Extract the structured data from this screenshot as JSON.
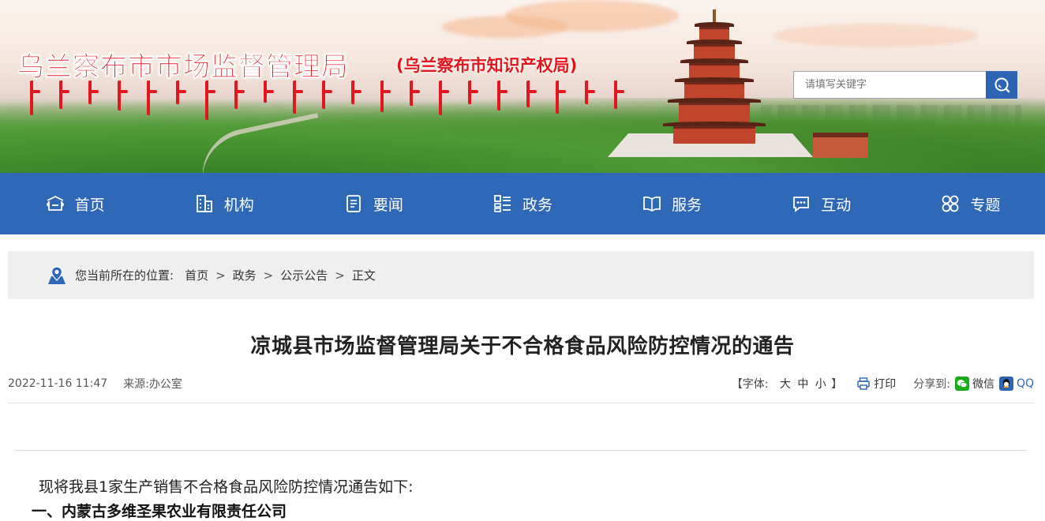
{
  "header": {
    "title": "乌兰察布市市场监督管理局",
    "subtitle": "(乌兰察布市知识产权局)",
    "search": {
      "placeholder": "请填写关键字"
    }
  },
  "nav": {
    "items": [
      {
        "label": "首页",
        "icon": "home-icon"
      },
      {
        "label": "机构",
        "icon": "building-icon"
      },
      {
        "label": "要闻",
        "icon": "news-icon"
      },
      {
        "label": "政务",
        "icon": "grid-list-icon"
      },
      {
        "label": "服务",
        "icon": "book-icon"
      },
      {
        "label": "互动",
        "icon": "chat-icon"
      },
      {
        "label": "专题",
        "icon": "clover-icon"
      }
    ]
  },
  "breadcrumb": {
    "prefix": "您当前所在的位置:",
    "items": [
      "首页",
      "政务",
      "公示公告",
      "正文"
    ],
    "separator": ">"
  },
  "article": {
    "title": "凉城县市场监督管理局关于不合格食品风险防控情况的通告",
    "date": "2022-11-16 11:47",
    "source": "来源:办公室",
    "font_label_open": "【字体:",
    "font_sizes": [
      "大",
      "中",
      "小"
    ],
    "font_label_close": "】",
    "print_label": "打印",
    "share_label": "分享到:",
    "share_wechat": "微信",
    "share_qq": "QQ",
    "paragraph1": "现将我县1家生产销售不合格食品风险防控情况通告如下:",
    "paragraph2": "一、内蒙古多维圣果农业有限责任公司"
  },
  "colors": {
    "nav_bg": "#2f68b7",
    "title_red": "#e0171f",
    "search_btn": "#2d64b3",
    "crumb_bg": "#efefef"
  }
}
